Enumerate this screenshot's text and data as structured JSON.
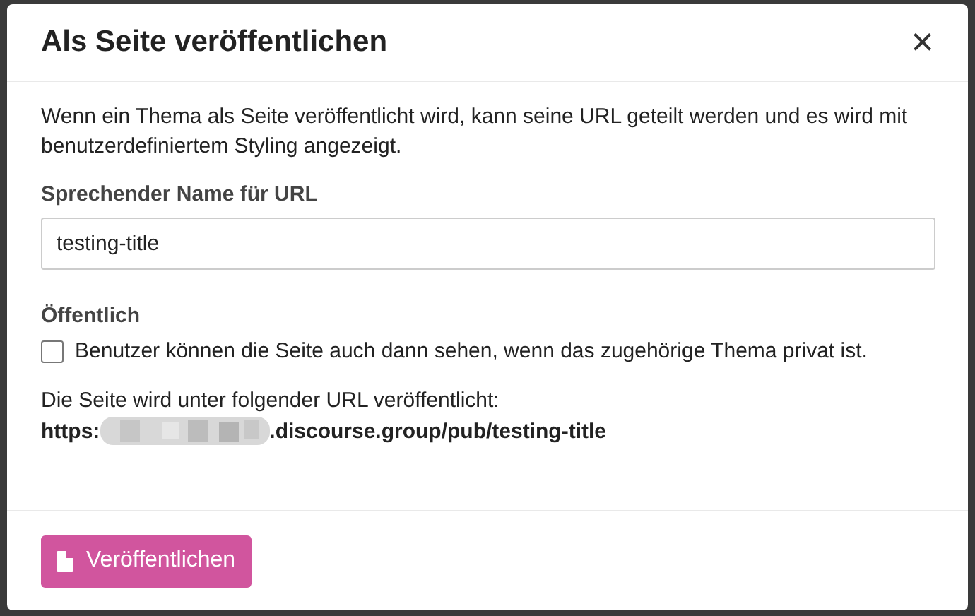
{
  "dialog": {
    "title": "Als Seite veröffentlichen",
    "close": "×",
    "description": "Wenn ein Thema als Seite veröffentlicht wird, kann seine URL geteilt werden und es wird mit benutzerdefiniertem Styling angezeigt.",
    "slug_label": "Sprechender Name für URL",
    "slug_value": "testing-title",
    "public_label": "Öffentlich",
    "public_option": {
      "label": "Benutzer können die Seite auch dann sehen, wenn das zugehörige Thema privat ist.",
      "checked": false
    },
    "url_intro": "Die Seite wird unter folgender URL veröffentlicht:",
    "url_start": "https:",
    "url_end": ".discourse.group/pub/testing-title",
    "publish_button": "Veröffentlichen"
  }
}
